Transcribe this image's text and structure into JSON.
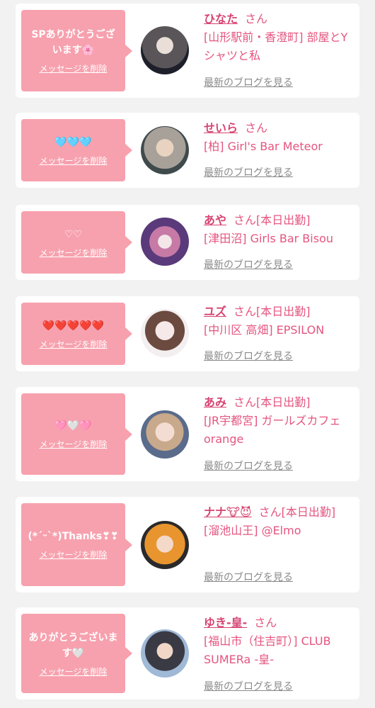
{
  "delete_label": "メッセージを削除",
  "blog_label": "最新のブログを見る",
  "colors": {
    "bubble": "#f7a1ae",
    "name": "#d64472",
    "text": "#e5557f",
    "link_gray": "#8a8a8a"
  },
  "items": [
    {
      "message": "SPありがとうございます🌸",
      "name": "ひなた",
      "san": "さん",
      "shop": "[山形駅前・香澄町] 部屋とYシャツと私"
    },
    {
      "message": "🩵🩵🩵",
      "name": "せいら",
      "san": "さん",
      "shop": "[柏] Girl's Bar Meteor"
    },
    {
      "message": "♡♡",
      "name": "あや",
      "san": "さん[本日出勤]",
      "shop": "[津田沼] Girls Bar Bisou"
    },
    {
      "message": "❤️❤️❤️❤️❤️",
      "name": "ユズ",
      "san": "さん[本日出勤]",
      "shop": "[中川区 高畑] EPSILON"
    },
    {
      "message": "🩷🤍🩷",
      "name": "あみ",
      "san": "さん[本日出勤]",
      "shop": "[JR宇都宮] ガールズカフェ orange"
    },
    {
      "message": "(*ˊᵕˋ*)Thanks❣❣",
      "name": "ナナ🐮😈",
      "san": "さん[本日出勤]",
      "shop": "[溜池山王] @Elmo"
    },
    {
      "message": "ありがとうございます🤍",
      "name": "ゆき-皇-",
      "san": "さん",
      "shop": "[福山市（住吉町）] CLUB SUMERa -皇-"
    }
  ]
}
